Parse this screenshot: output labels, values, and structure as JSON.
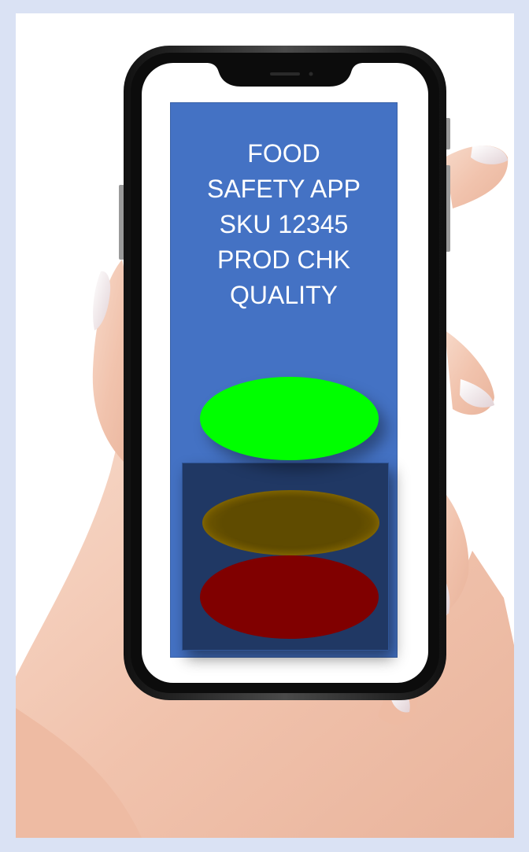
{
  "app": {
    "title_lines": [
      "FOOD",
      "SAFETY APP",
      "SKU 12345",
      "PROD CHK",
      "QUALITY"
    ]
  },
  "status_lights": [
    {
      "name": "green",
      "color": "#00ff00",
      "state": "on"
    },
    {
      "name": "amber",
      "color": "#5f4b00",
      "state": "off"
    },
    {
      "name": "red",
      "color": "#800000",
      "state": "off"
    }
  ],
  "colors": {
    "background": "#dae2f4",
    "screen": "#4472c4",
    "panel": "#203864",
    "skin": "#f4cdb8"
  },
  "icons": {
    "phone": "smartphone-outline",
    "hand": "hand-holding-phone"
  }
}
